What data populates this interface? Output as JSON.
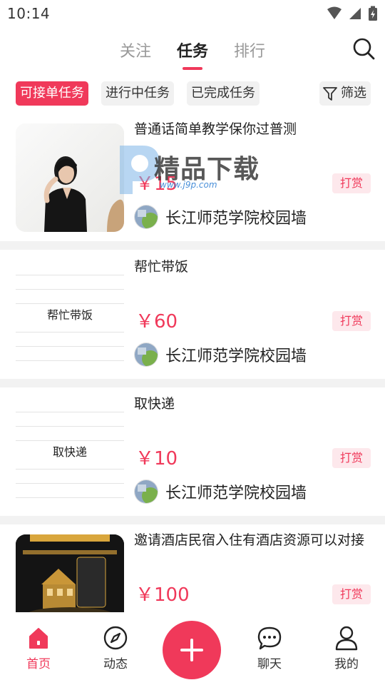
{
  "status_bar": {
    "time": "10:14",
    "icons": [
      "wifi-icon",
      "signal-icon",
      "battery-charging-icon"
    ]
  },
  "top_nav": {
    "tabs": [
      {
        "label": "关注",
        "active": false
      },
      {
        "label": "任务",
        "active": true
      },
      {
        "label": "排行",
        "active": false
      }
    ],
    "search_icon": "search-icon"
  },
  "filters": {
    "chips": [
      {
        "label": "可接单任务",
        "active": true
      },
      {
        "label": "进行中任务",
        "active": false
      },
      {
        "label": "已完成任务",
        "active": false
      }
    ],
    "filter_label": "筛选",
    "filter_icon": "funnel-icon"
  },
  "tasks": [
    {
      "title": "普通话简单教学保你过普测",
      "price": "￥15",
      "reward_tag": "打赏",
      "publisher": "长江师范学院校园墙",
      "thumb_text": ""
    },
    {
      "title": "帮忙带饭",
      "price": "￥60",
      "reward_tag": "打赏",
      "publisher": "长江师范学院校园墙",
      "thumb_text": "帮忙带饭"
    },
    {
      "title": "取快递",
      "price": "￥10",
      "reward_tag": "打赏",
      "publisher": "长江师范学院校园墙",
      "thumb_text": "取快递"
    },
    {
      "title": "邀请酒店民宿入住有酒店资源可以对接",
      "price": "￥100",
      "reward_tag": "打赏",
      "publisher": "",
      "thumb_text": ""
    }
  ],
  "watermark": {
    "brand": "精品下载",
    "url": "www.j9p.com"
  },
  "bottom_nav": {
    "items": [
      {
        "label": "首页",
        "icon": "home-icon",
        "active": true
      },
      {
        "label": "动态",
        "icon": "compass-icon",
        "active": false
      },
      {
        "label": "聊天",
        "icon": "chat-bubble-icon",
        "active": false
      },
      {
        "label": "我的",
        "icon": "user-icon",
        "active": false
      }
    ],
    "fab_icon": "plus-icon"
  },
  "colors": {
    "accent": "#f0395a",
    "accent_light": "#fde8ec",
    "chip_bg": "#f1f1f1",
    "divider": "#f2f2f2"
  }
}
